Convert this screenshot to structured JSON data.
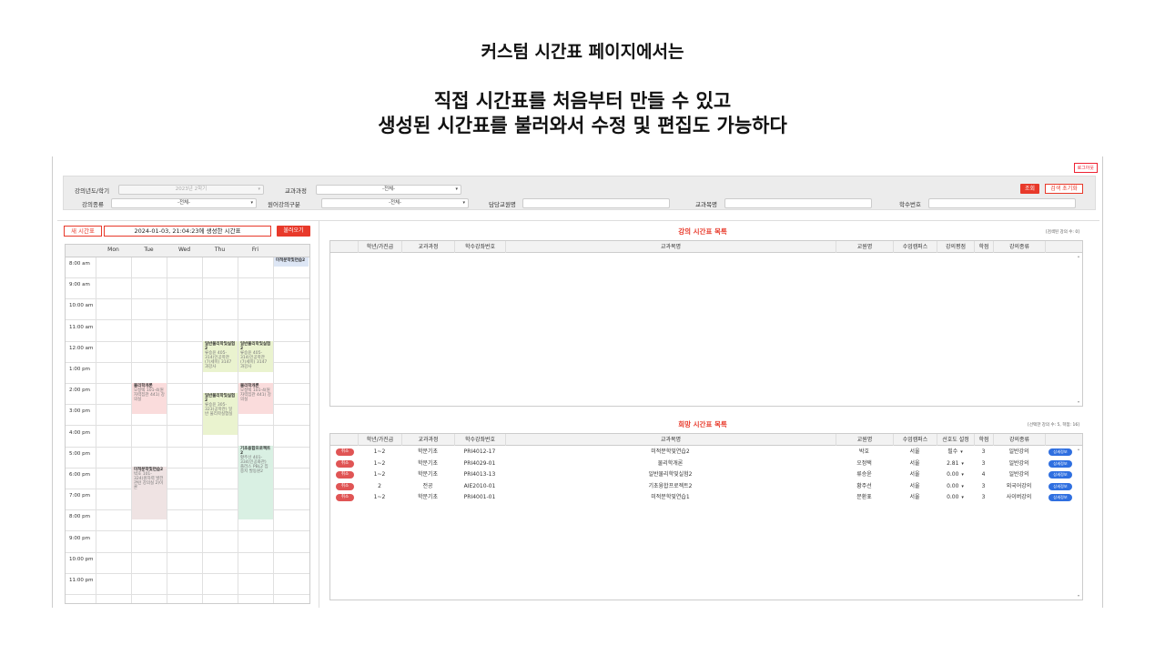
{
  "captions": {
    "line1": "커스텀 시간표 페이지에서는",
    "line2": "직접 시간표를 처음부터 만들 수 있고",
    "line3": "생성된 시간표를 불러와서 수정 및 편집도 가능하다"
  },
  "header": {
    "logout": "로그아웃"
  },
  "filters": {
    "year_label": "강의년도/학기",
    "year_value": "2023년 2학기",
    "curriculum_label": "교과과정",
    "curriculum_value": "-전체-",
    "type_label": "강의종류",
    "type_value": "-전체-",
    "lang_label": "원어강의구분",
    "lang_value": "-전체-",
    "prof_label": "담당교원명",
    "subject_label": "교과목명",
    "code_label": "학수번호",
    "search_btn": "조회",
    "reset_btn": "검색 초기화"
  },
  "timetable": {
    "name_label": "새 시간표",
    "title": "2024-01-03, 21:04:23에 생성한 시간표",
    "load_btn": "불러오기",
    "days": [
      "Mon",
      "Tue",
      "Wed",
      "Thu",
      "Fri"
    ],
    "times": [
      "8:00 am",
      "9:00 am",
      "10:00 am",
      "11:00 am",
      "12:00 am",
      "1:00 pm",
      "2:00 pm",
      "3:00 pm",
      "4:00 pm",
      "5:00 pm",
      "6:00 pm",
      "7:00 pm",
      "8:00 pm",
      "9:00 pm",
      "10:00 pm",
      "11:00 pm"
    ],
    "events": [
      {
        "title": "미적분학및연습2",
        "detail": "",
        "color": "#dde6f5"
      },
      {
        "title": "일반물리학및실험2",
        "detail": "류승윤 405-314(인공학관 (7)세미) 3147 과강사",
        "color": "#eaf3cf"
      },
      {
        "title": "일반물리학및실험2",
        "detail": "류승윤 405-314(인공학관 (7)세미) 3147 과강사",
        "color": "#eaf3cf"
      },
      {
        "title": "물리학개론",
        "detail": "오정택 101-4(원자력집관 441) 강의실",
        "color": "#fadcdc"
      },
      {
        "title": "일반물리학및실험2",
        "detail": "류승윤 305-323(공학관) 일반 물리학실험실",
        "color": "#eaf3cf"
      },
      {
        "title": "물리학개론",
        "detail": "오정택 101-4(원자력집관 441) 강의실",
        "color": "#fadcdc"
      },
      {
        "title": "기초융합프로젝트2",
        "detail": "황주선 401-334(인공화관) 플러스 PBL2 집중지 발동원2",
        "color": "#d9f0e3"
      },
      {
        "title": "미적분학및연습2",
        "detail": "박호 101-324(원자력 발전 관련 강의실 2)이론",
        "color": "#efe3e3"
      }
    ]
  },
  "course_list": {
    "title": "강의 시간표 목록",
    "count": "[검색된 강의 수: 0]",
    "headers": [
      "학년/가진급",
      "교과과정",
      "학수강좌번호",
      "교과목명",
      "교원명",
      "수업캠퍼스",
      "강의평점",
      "학점",
      "강의종류"
    ]
  },
  "wish_list": {
    "title": "희망 시간표 목록",
    "count": "[선택한 강의 수: 5, 학점: 16]",
    "headers": [
      "학년/가진급",
      "교과과정",
      "학수강좌번호",
      "교과목명",
      "교원명",
      "수업캠퍼스",
      "선호도 설정",
      "학점",
      "강의종류"
    ],
    "delete_label": "취소",
    "detail_label": "상세정보",
    "rows": [
      {
        "grade": "1~2",
        "curriculum": "학문기초",
        "code": "PRI4012-17",
        "name": "미적분학및연습2",
        "prof": "박호",
        "campus": "서울",
        "pref": "필수",
        "credit": "3",
        "type": "일반강의"
      },
      {
        "grade": "1~2",
        "curriculum": "학문기초",
        "code": "PRI4029-01",
        "name": "물리학개론",
        "prof": "오정택",
        "campus": "서울",
        "pref": "2.81",
        "credit": "3",
        "type": "일반강의"
      },
      {
        "grade": "1~2",
        "curriculum": "학문기초",
        "code": "PRI4013-13",
        "name": "일반물리학및실험2",
        "prof": "류승윤",
        "campus": "서울",
        "pref": "0.00",
        "credit": "4",
        "type": "일반강의"
      },
      {
        "grade": "2",
        "curriculum": "전공",
        "code": "AIE2010-01",
        "name": "기초융합프로젝트2",
        "prof": "황주선",
        "campus": "서울",
        "pref": "0.00",
        "credit": "3",
        "type": "외국어강의"
      },
      {
        "grade": "1~2",
        "curriculum": "학문기초",
        "code": "PRI4001-01",
        "name": "미적분학및연습1",
        "prof": "문환표",
        "campus": "서울",
        "pref": "0.00",
        "credit": "3",
        "type": "사이버강의"
      }
    ]
  }
}
